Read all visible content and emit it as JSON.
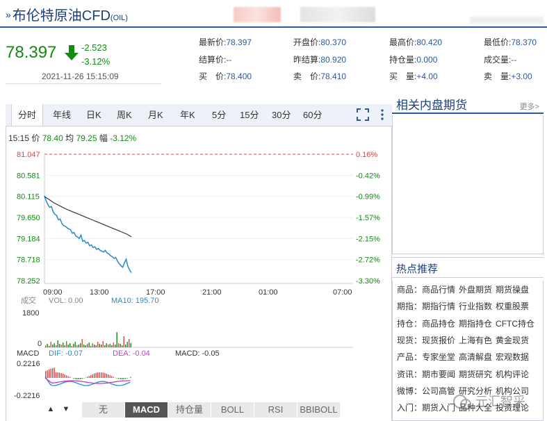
{
  "header": {
    "title": "布伦特原油CFD",
    "code": "(OIL)"
  },
  "quote": {
    "price": "78.397",
    "change": "-2.523",
    "change_pct": "-3.12%",
    "timestamp": "2021-11-26 15:15:09",
    "fields": [
      [
        {
          "label": "最新价:",
          "value": "78.397"
        },
        {
          "label": "开盘价:",
          "value": "80.370"
        },
        {
          "label": "最高价:",
          "value": "80.420"
        },
        {
          "label": "最低价:",
          "value": "78.370"
        }
      ],
      [
        {
          "label": "结算价:",
          "value": "--"
        },
        {
          "label": "昨结算:",
          "value": "80.920"
        },
        {
          "label": "持仓量:",
          "value": "0.000"
        },
        {
          "label": "成交量:",
          "value": "--"
        }
      ],
      [
        {
          "label": "买　价:",
          "value": "78.400"
        },
        {
          "label": "卖　价:",
          "value": "78.410"
        },
        {
          "label": "买　量:",
          "value": "+4.00"
        },
        {
          "label": "卖　量:",
          "value": "+3.00"
        }
      ]
    ]
  },
  "tabs": [
    "分时",
    "年线",
    "日K",
    "周K",
    "月K",
    "年K",
    "5分",
    "15分",
    "30分",
    "60分"
  ],
  "info_bar": {
    "time": "15:15",
    "price_label": "价",
    "price": "78.40",
    "avg_label": "均",
    "avg": "79.25",
    "range_label": "幅",
    "range": "-3.12%"
  },
  "chart_data": {
    "type": "line",
    "y_ticks": [
      "81.047",
      "80.581",
      "80.115",
      "79.650",
      "79.184",
      "78.718",
      "78.252"
    ],
    "pct_ticks": [
      "0.16%",
      "-0.42%",
      "-0.99%",
      "-1.57%",
      "-2.15%",
      "-2.72%",
      "-3.30%"
    ],
    "ylim": [
      78.252,
      81.047
    ],
    "x_ticks": [
      "09:00",
      "13:00",
      "17:00",
      "21:00",
      "01:00",
      "07:00"
    ],
    "series": [
      {
        "name": "价",
        "color": "#2a8ac8",
        "x": [
          0,
          0.02,
          0.04,
          0.06,
          0.08,
          0.1,
          0.12,
          0.14,
          0.16,
          0.18,
          0.2,
          0.22,
          0.24,
          0.26,
          0.28,
          0.3,
          0.32,
          0.34,
          0.36,
          0.38,
          0.4,
          0.42,
          0.44,
          0.46,
          0.48,
          0.5,
          0.52,
          0.54,
          0.56,
          0.58,
          0.6,
          0.62,
          0.64,
          0.66,
          0.68,
          0.7,
          0.72,
          0.74,
          0.76,
          0.78,
          0.8,
          0.82,
          0.84,
          0.86,
          0.88,
          0.9,
          0.92,
          0.94,
          0.96,
          0.98,
          1.0
        ],
        "values": [
          80.12,
          80.0,
          79.92,
          79.86,
          79.88,
          79.76,
          79.7,
          79.68,
          79.58,
          79.6,
          79.5,
          79.45,
          79.44,
          79.4,
          79.38,
          79.36,
          79.28,
          79.3,
          79.22,
          79.2,
          79.16,
          79.24,
          79.1,
          79.12,
          79.06,
          79.08,
          79.0,
          79.02,
          78.96,
          78.98,
          78.92,
          78.94,
          78.9,
          78.88,
          78.86,
          78.9,
          78.84,
          78.82,
          78.78,
          78.76,
          78.72,
          78.74,
          78.66,
          78.6,
          78.56,
          78.52,
          78.62,
          78.7,
          78.54,
          78.46,
          78.4
        ]
      },
      {
        "name": "均",
        "color": "#333333",
        "x": [
          0,
          0.05,
          0.1,
          0.15,
          0.2,
          0.25,
          0.3,
          0.35,
          0.4,
          0.45,
          0.5,
          0.55,
          0.6,
          0.65,
          0.7,
          0.75,
          0.8,
          0.85,
          0.9,
          0.95,
          1.0
        ],
        "values": [
          80.1,
          80.04,
          79.97,
          79.92,
          79.87,
          79.82,
          79.78,
          79.74,
          79.7,
          79.66,
          79.62,
          79.58,
          79.54,
          79.5,
          79.46,
          79.42,
          79.38,
          79.34,
          79.3,
          79.26,
          79.2
        ]
      }
    ],
    "volume": {
      "label": "成交",
      "vol_label": "VOL: 0.00",
      "ma_label": "MA10: 195.70",
      "max_label": "1800",
      "zero_label": "0"
    },
    "macd": {
      "label": "MACD",
      "dif": "DIF: -0.07",
      "dea": "DEA: -0.04",
      "macd": "MACD: -0.05",
      "top": "0.2216",
      "bottom": "-0.2216"
    }
  },
  "indicator_tabs": [
    "无",
    "MACD",
    "持仓量",
    "BOLL",
    "RSI",
    "BBIBOLL"
  ],
  "active_indicator": "MACD",
  "sidebar": {
    "section_title": "相关内盘期货",
    "more": "更多>",
    "hot_title": "热点推荐",
    "hot_rows": [
      {
        "key": "商品：",
        "links": [
          "商品行情",
          "外盘期货",
          "期货操盘"
        ]
      },
      {
        "key": "期指：",
        "links": [
          "期指行情",
          "行业指数",
          "权重股票"
        ]
      },
      {
        "key": "持仓：",
        "links": [
          "商品持仓",
          "期指持仓",
          "CFTC持仓"
        ]
      },
      {
        "key": "现货：",
        "links": [
          "现货报价",
          "上海有色",
          "黄金现货"
        ]
      },
      {
        "key": "产品：",
        "links": [
          "专家坐堂",
          "高清解盘",
          "宏观数据"
        ]
      },
      {
        "key": "资讯：",
        "links": [
          "期市要闻",
          "期货研究",
          "机构评论"
        ]
      },
      {
        "key": "微博：",
        "links": [
          "公司高管",
          "研究分析",
          "机构公司"
        ]
      },
      {
        "key": "入门：",
        "links": [
          "期货入门",
          "品种大全",
          "投资理论"
        ]
      }
    ]
  },
  "watermark": "元汇智采"
}
